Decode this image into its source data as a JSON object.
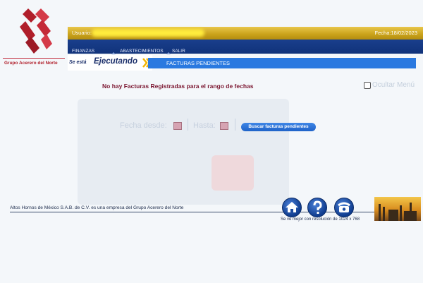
{
  "header": {
    "brand_name": "Grupo Acerero del Norte",
    "user_label": "Usuario:",
    "date_text": "Fecha:18/02/2023"
  },
  "menu": {
    "items": [
      "FINANZAS",
      "ABASTECIMIENTOS",
      "SALIR"
    ]
  },
  "banner": {
    "small": "Se está",
    "big": "Ejecutando",
    "section_title": "FACTURAS PENDIENTES"
  },
  "main": {
    "message": "No hay Facturas Registradas para el rango de fechas",
    "hide_label": "Ocultar Menú"
  },
  "filters": {
    "fecha_desde_label": "Fecha desde:",
    "hasta_label": "Hasta:",
    "search_button": "Buscar facturas pendientes"
  },
  "footer": {
    "company_text": "Altos Hornos de México S.A.B. de C.V.  es una empresa del  Grupo Acerero del Norte",
    "resolution_text": "Se ve mejor con resolución de 1024 x 768",
    "icons": [
      "home-icon",
      "help-icon",
      "phone-icon"
    ]
  },
  "colors": {
    "gold": "#c9a21a",
    "navy": "#10327a",
    "title_blue": "#2a79e0",
    "message_red": "#7b1630"
  }
}
